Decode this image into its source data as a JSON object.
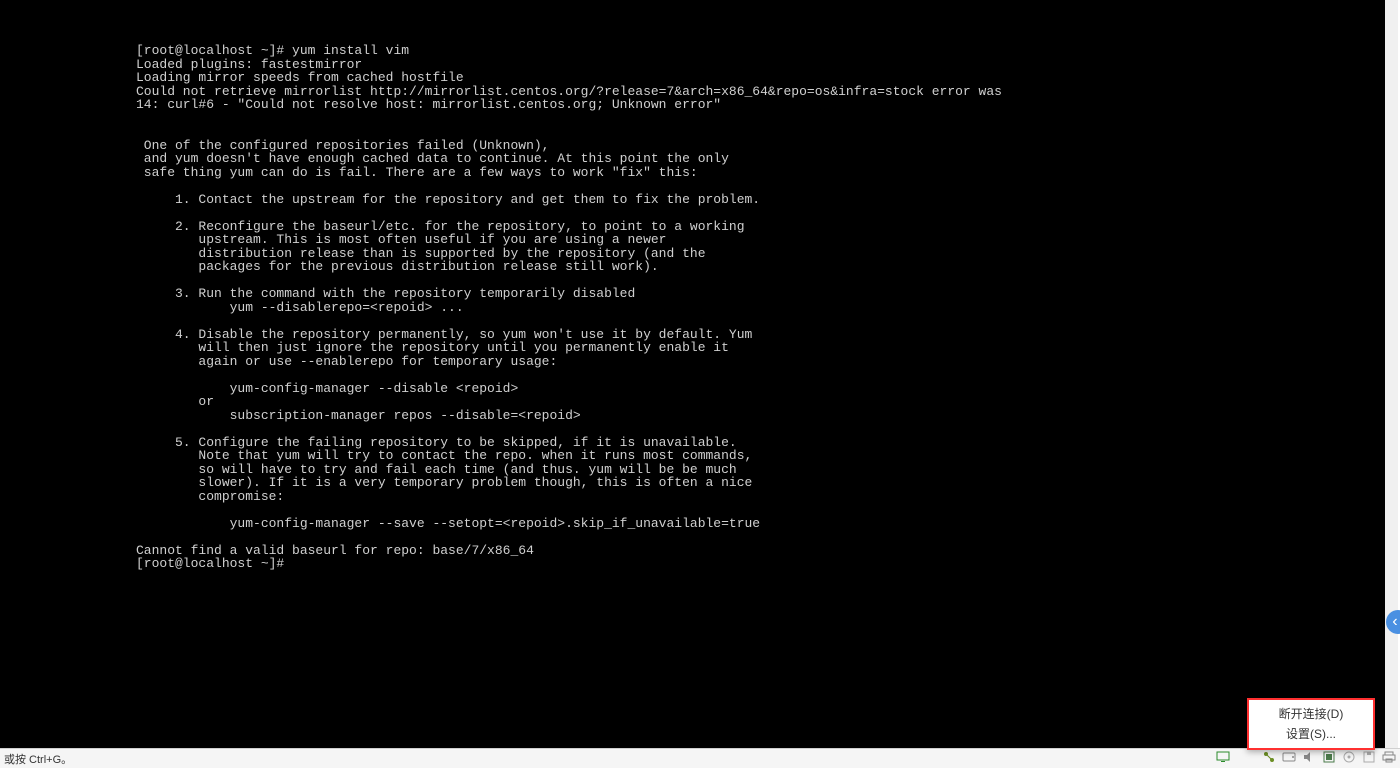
{
  "terminal": {
    "lines": [
      "[root@localhost ~]# yum install vim",
      "Loaded plugins: fastestmirror",
      "Loading mirror speeds from cached hostfile",
      "Could not retrieve mirrorlist http://mirrorlist.centos.org/?release=7&arch=x86_64&repo=os&infra=stock error was",
      "14: curl#6 - \"Could not resolve host: mirrorlist.centos.org; Unknown error\"",
      "",
      "",
      " One of the configured repositories failed (Unknown),",
      " and yum doesn't have enough cached data to continue. At this point the only",
      " safe thing yum can do is fail. There are a few ways to work \"fix\" this:",
      "",
      "     1. Contact the upstream for the repository and get them to fix the problem.",
      "",
      "     2. Reconfigure the baseurl/etc. for the repository, to point to a working",
      "        upstream. This is most often useful if you are using a newer",
      "        distribution release than is supported by the repository (and the",
      "        packages for the previous distribution release still work).",
      "",
      "     3. Run the command with the repository temporarily disabled",
      "            yum --disablerepo=<repoid> ...",
      "",
      "     4. Disable the repository permanently, so yum won't use it by default. Yum",
      "        will then just ignore the repository until you permanently enable it",
      "        again or use --enablerepo for temporary usage:",
      "",
      "            yum-config-manager --disable <repoid>",
      "        or",
      "            subscription-manager repos --disable=<repoid>",
      "",
      "     5. Configure the failing repository to be skipped, if it is unavailable.",
      "        Note that yum will try to contact the repo. when it runs most commands,",
      "        so will have to try and fail each time (and thus. yum will be be much",
      "        slower). If it is a very temporary problem though, this is often a nice",
      "        compromise:",
      "",
      "            yum-config-manager --save --setopt=<repoid>.skip_if_unavailable=true",
      "",
      "Cannot find a valid baseurl for repo: base/7/x86_64",
      "[root@localhost ~]# "
    ]
  },
  "statusbar": {
    "left_text": "或按 Ctrl+G。"
  },
  "context_menu": {
    "items": [
      {
        "label": "断开连接(D)"
      },
      {
        "label": "设置(S)..."
      }
    ]
  }
}
